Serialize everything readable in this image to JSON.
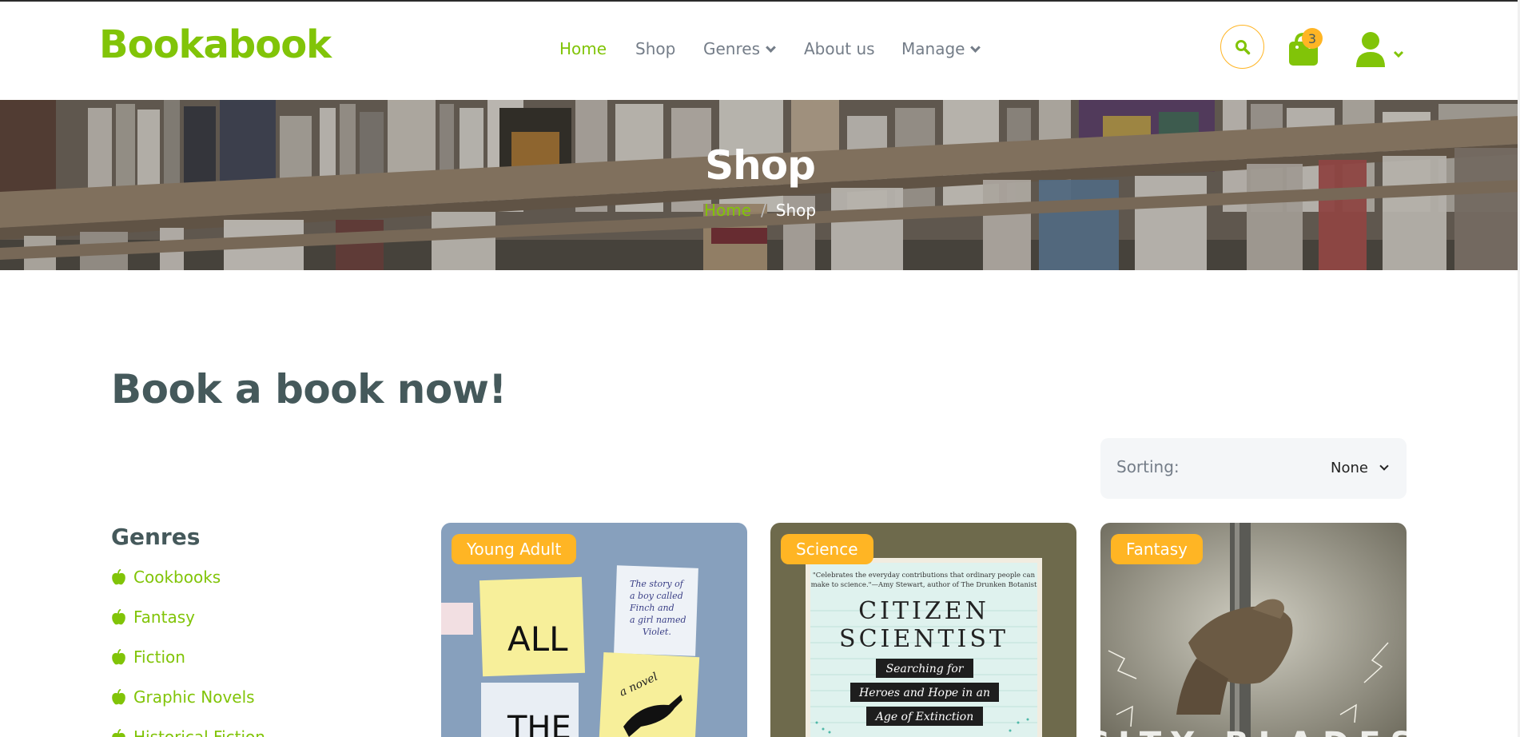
{
  "brand": {
    "name": "Bookabook",
    "color": "#81c408"
  },
  "nav": {
    "items": [
      {
        "label": "Home",
        "active": true
      },
      {
        "label": "Shop"
      },
      {
        "label": "Genres",
        "dropdown": true
      },
      {
        "label": "About us"
      },
      {
        "label": "Manage",
        "dropdown": true
      }
    ],
    "cart_count": "3",
    "icons": [
      "search-icon",
      "shopping-bag-icon",
      "user-icon",
      "chevron-down-icon"
    ]
  },
  "hero": {
    "title": "Shop",
    "breadcrumb": {
      "home": "Home",
      "separator": "/",
      "current": "Shop"
    }
  },
  "main": {
    "heading": "Book a book now!",
    "sorting": {
      "label": "Sorting:",
      "value": "None"
    },
    "genres": {
      "title": "Genres",
      "items": [
        "Cookbooks",
        "Fantasy",
        "Fiction",
        "Graphic Novels",
        "Historical Fiction"
      ]
    },
    "books": [
      {
        "genre": "Young Adult"
      },
      {
        "genre": "Science"
      },
      {
        "genre": "Fantasy"
      }
    ]
  },
  "colors": {
    "accent": "#81c408",
    "secondary": "#ffb524",
    "text": "#45595b",
    "muted": "#747d88"
  }
}
